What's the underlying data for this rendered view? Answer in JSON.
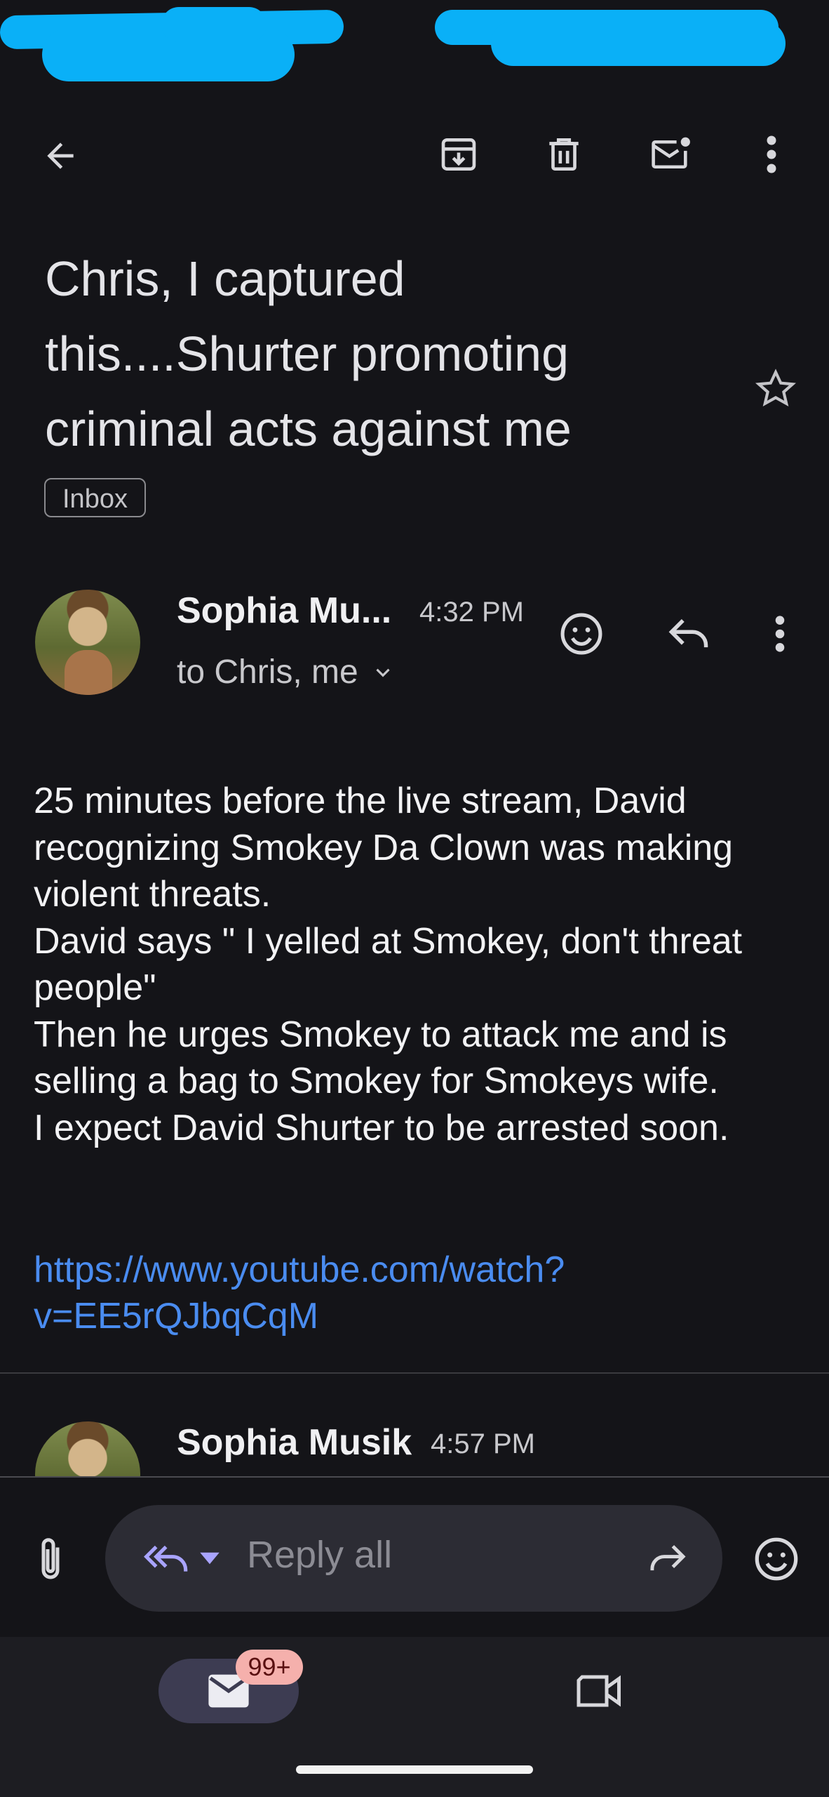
{
  "toolbar": {
    "back_icon": "arrow-left-icon",
    "archive_icon": "archive-icon",
    "delete_icon": "trash-icon",
    "mark_unread_icon": "mail-unread-icon",
    "more_icon": "more-vert-icon"
  },
  "subject": "Chris, I captured this....Shurter promoting criminal acts against me",
  "label_chip": "Inbox",
  "message": {
    "sender": "Sophia Mu...",
    "time": "4:32 PM",
    "recipients": "to Chris, me",
    "body": "25 minutes before the live stream, David recognizing Smokey Da Clown was making violent threats.\nDavid says \" I yelled at Smokey, don't threat people\"\nThen he urges Smokey to attack me and is selling a bag to Smokey for Smokeys wife.\nI expect David Shurter to be arrested soon.",
    "link": "https://www.youtube.com/watch?\nv=EE5rQJbqCqM"
  },
  "next_message": {
    "sender": "Sophia Musik",
    "time": "4:57 PM"
  },
  "reply_bar": {
    "placeholder": "Reply all"
  },
  "bottom_nav": {
    "mail_badge": "99+"
  },
  "colors": {
    "background": "#141418",
    "link": "#4a8cf0",
    "reply_accent": "#a9a4ff",
    "badge": "#f5b0ac"
  }
}
